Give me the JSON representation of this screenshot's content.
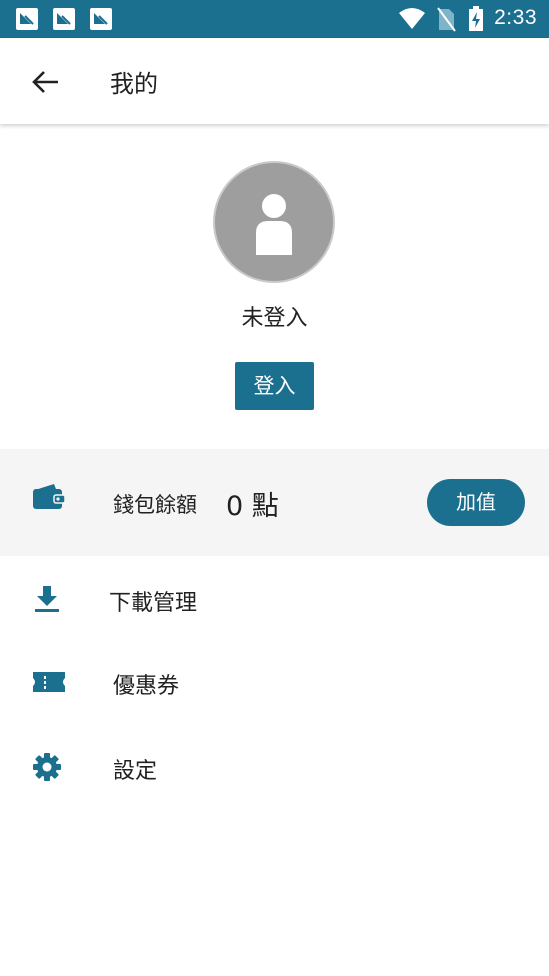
{
  "status_bar": {
    "time": "2:33",
    "notification_icons": [
      "app-notification-icon",
      "app-notification-icon",
      "app-notification-icon"
    ],
    "system_icons": [
      "wifi-icon",
      "no-sim-icon",
      "battery-charging-icon"
    ]
  },
  "app_bar": {
    "back_icon": "arrow-back-icon",
    "title": "我的"
  },
  "profile": {
    "avatar_icon": "person-icon",
    "status_text": "未登入",
    "login_label": "登入"
  },
  "wallet": {
    "icon": "wallet-icon",
    "label": "錢包餘額",
    "amount": "0 點",
    "topup_label": "加值"
  },
  "menu": {
    "items": [
      {
        "icon": "download-icon",
        "label": "下載管理"
      },
      {
        "icon": "ticket-icon",
        "label": "優惠券"
      },
      {
        "icon": "gear-icon",
        "label": "設定"
      }
    ]
  },
  "colors": {
    "primary": "#1b6f8f",
    "avatar_bg": "#9e9e9e",
    "wallet_row_bg": "#f5f5f5",
    "text": "#212121"
  }
}
